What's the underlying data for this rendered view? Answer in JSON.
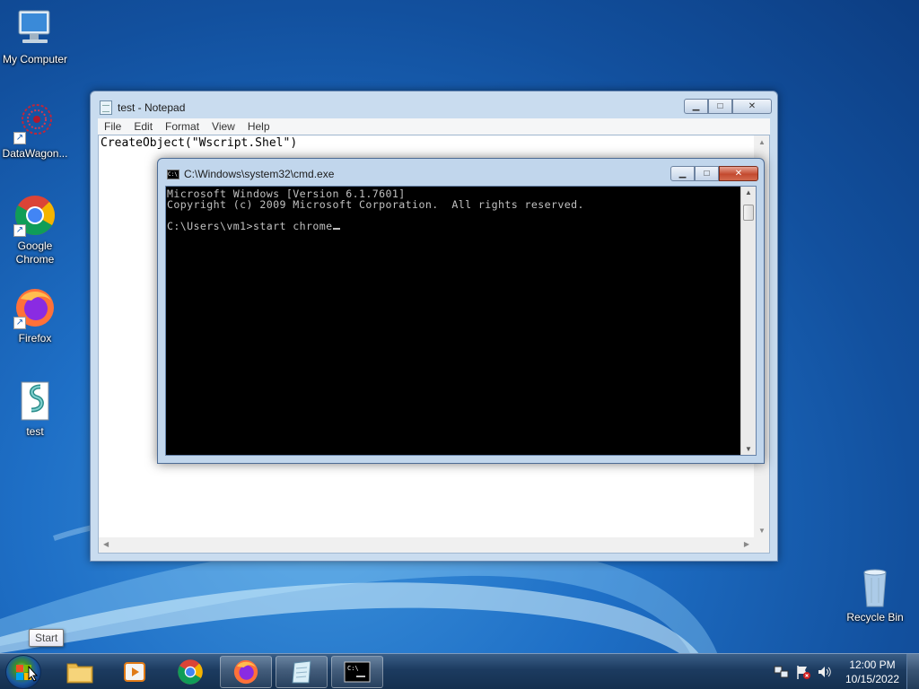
{
  "desktop": {
    "icons": [
      {
        "label": "My Computer",
        "icon": "computer-icon"
      },
      {
        "label": "DataWagon...",
        "icon": "datawagon-icon"
      },
      {
        "label": "Google Chrome",
        "icon": "chrome-icon"
      },
      {
        "label": "Firefox",
        "icon": "firefox-icon"
      },
      {
        "label": "test",
        "icon": "script-file-icon"
      },
      {
        "label": "Recycle Bin",
        "icon": "recycle-bin-icon"
      }
    ]
  },
  "notepad": {
    "title": "test - Notepad",
    "menu": [
      "File",
      "Edit",
      "Format",
      "View",
      "Help"
    ],
    "content": "CreateObject(\"Wscript.Shel\")"
  },
  "cmd": {
    "title": "C:\\Windows\\system32\\cmd.exe",
    "lines": [
      "Microsoft Windows [Version 6.1.7601]",
      "Copyright (c) 2009 Microsoft Corporation.  All rights reserved.",
      "",
      "C:\\Users\\vm1>start chrome"
    ]
  },
  "taskbar": {
    "start_tooltip": "Start",
    "pinned": [
      {
        "name": "explorer",
        "icon": "folder-icon"
      },
      {
        "name": "media-player",
        "icon": "media-player-icon"
      },
      {
        "name": "chrome",
        "icon": "chrome-icon"
      },
      {
        "name": "firefox",
        "icon": "firefox-icon"
      },
      {
        "name": "notepad",
        "icon": "notepad-icon"
      },
      {
        "name": "cmd",
        "icon": "cmd-icon"
      }
    ],
    "clock": {
      "time": "12:00 PM",
      "date": "10/15/2022"
    }
  },
  "colors": {
    "desktop_bg": "#1e6fc6",
    "cmd_bg": "#000000",
    "cmd_text": "#c0c0c0",
    "close_red": "#c44a2f"
  }
}
